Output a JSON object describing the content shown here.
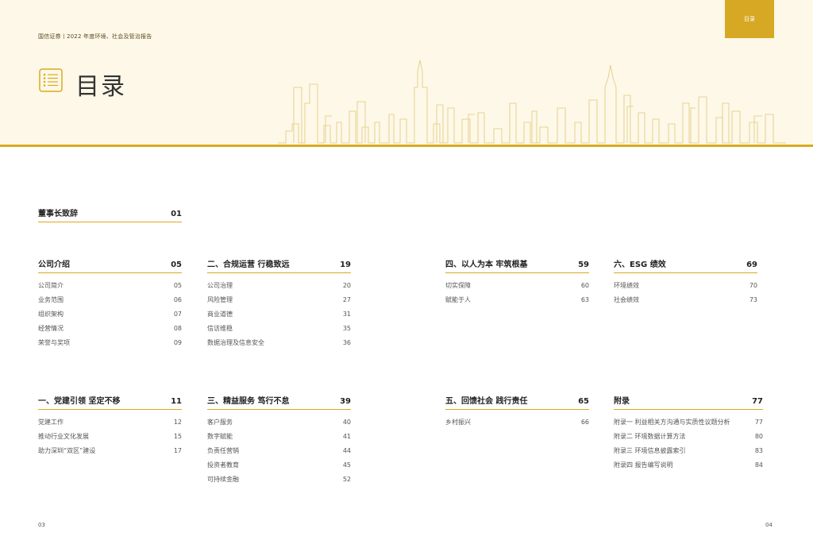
{
  "header": {
    "report_title": "国信证券丨2022 年度环境、社会及管治报告",
    "tab_label": "目录",
    "page_heading": "目录"
  },
  "sections": [
    {
      "title": "董事长致辞",
      "page": "01",
      "items": []
    },
    {
      "title": "公司介绍",
      "page": "05",
      "items": [
        {
          "label": "公司简介",
          "page": "05"
        },
        {
          "label": "业务范围",
          "page": "06"
        },
        {
          "label": "组织架构",
          "page": "07"
        },
        {
          "label": "经营情况",
          "page": "08"
        },
        {
          "label": "荣誉与奖项",
          "page": "09"
        }
      ]
    },
    {
      "title": "二、合规运营 行稳致远",
      "page": "19",
      "items": [
        {
          "label": "公司治理",
          "page": "20"
        },
        {
          "label": "风险管理",
          "page": "27"
        },
        {
          "label": "商业道德",
          "page": "31"
        },
        {
          "label": "信访维稳",
          "page": "35"
        },
        {
          "label": "数据治理及信息安全",
          "page": "36"
        }
      ]
    },
    {
      "title": "四、以人为本 牢筑根基",
      "page": "59",
      "items": [
        {
          "label": "切实保障",
          "page": "60"
        },
        {
          "label": "赋能于人",
          "page": "63"
        }
      ]
    },
    {
      "title": "六、ESG 绩效",
      "page": "69",
      "items": [
        {
          "label": "环境绩效",
          "page": "70"
        },
        {
          "label": "社会绩效",
          "page": "73"
        }
      ]
    },
    {
      "title": "一、党建引领 坚定不移",
      "page": "11",
      "items": [
        {
          "label": "党建工作",
          "page": "12"
        },
        {
          "label": "推动行业文化发展",
          "page": "15"
        },
        {
          "label": "助力深圳“双区”建设",
          "page": "17"
        }
      ]
    },
    {
      "title": "三、精益服务 笃行不怠",
      "page": "39",
      "items": [
        {
          "label": "客户服务",
          "page": "40"
        },
        {
          "label": "数字赋能",
          "page": "41"
        },
        {
          "label": "负责任营销",
          "page": "44"
        },
        {
          "label": "投资者教育",
          "page": "45"
        },
        {
          "label": "可持续金融",
          "page": "52"
        }
      ]
    },
    {
      "title": "五、回馈社会 践行责任",
      "page": "65",
      "items": [
        {
          "label": "乡村振兴",
          "page": "66"
        }
      ]
    },
    {
      "title": "附录",
      "page": "77",
      "items": [
        {
          "label": "附录一 利益相关方沟通与实质性议题分析",
          "page": "77"
        },
        {
          "label": "附录二 环境数据计算方法",
          "page": "80"
        },
        {
          "label": "附录三 环境信息披露索引",
          "page": "83"
        },
        {
          "label": "附录四 报告编写说明",
          "page": "84"
        }
      ]
    }
  ],
  "footer": {
    "left_page": "03",
    "right_page": "04"
  },
  "colors": {
    "accent": "#d9aa1e",
    "background": "#fdf8e8"
  },
  "icons": [
    "list-icon"
  ]
}
